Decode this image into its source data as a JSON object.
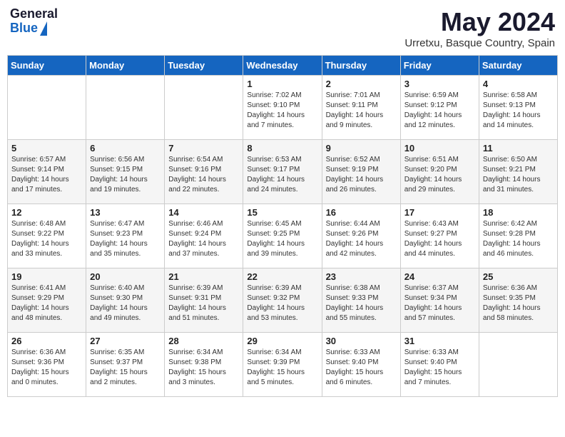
{
  "header": {
    "logo_general": "General",
    "logo_blue": "Blue",
    "month_year": "May 2024",
    "location": "Urretxu, Basque Country, Spain"
  },
  "weekdays": [
    "Sunday",
    "Monday",
    "Tuesday",
    "Wednesday",
    "Thursday",
    "Friday",
    "Saturday"
  ],
  "weeks": [
    [
      {
        "day": "",
        "info": ""
      },
      {
        "day": "",
        "info": ""
      },
      {
        "day": "",
        "info": ""
      },
      {
        "day": "1",
        "info": "Sunrise: 7:02 AM\nSunset: 9:10 PM\nDaylight: 14 hours\nand 7 minutes."
      },
      {
        "day": "2",
        "info": "Sunrise: 7:01 AM\nSunset: 9:11 PM\nDaylight: 14 hours\nand 9 minutes."
      },
      {
        "day": "3",
        "info": "Sunrise: 6:59 AM\nSunset: 9:12 PM\nDaylight: 14 hours\nand 12 minutes."
      },
      {
        "day": "4",
        "info": "Sunrise: 6:58 AM\nSunset: 9:13 PM\nDaylight: 14 hours\nand 14 minutes."
      }
    ],
    [
      {
        "day": "5",
        "info": "Sunrise: 6:57 AM\nSunset: 9:14 PM\nDaylight: 14 hours\nand 17 minutes."
      },
      {
        "day": "6",
        "info": "Sunrise: 6:56 AM\nSunset: 9:15 PM\nDaylight: 14 hours\nand 19 minutes."
      },
      {
        "day": "7",
        "info": "Sunrise: 6:54 AM\nSunset: 9:16 PM\nDaylight: 14 hours\nand 22 minutes."
      },
      {
        "day": "8",
        "info": "Sunrise: 6:53 AM\nSunset: 9:17 PM\nDaylight: 14 hours\nand 24 minutes."
      },
      {
        "day": "9",
        "info": "Sunrise: 6:52 AM\nSunset: 9:19 PM\nDaylight: 14 hours\nand 26 minutes."
      },
      {
        "day": "10",
        "info": "Sunrise: 6:51 AM\nSunset: 9:20 PM\nDaylight: 14 hours\nand 29 minutes."
      },
      {
        "day": "11",
        "info": "Sunrise: 6:50 AM\nSunset: 9:21 PM\nDaylight: 14 hours\nand 31 minutes."
      }
    ],
    [
      {
        "day": "12",
        "info": "Sunrise: 6:48 AM\nSunset: 9:22 PM\nDaylight: 14 hours\nand 33 minutes."
      },
      {
        "day": "13",
        "info": "Sunrise: 6:47 AM\nSunset: 9:23 PM\nDaylight: 14 hours\nand 35 minutes."
      },
      {
        "day": "14",
        "info": "Sunrise: 6:46 AM\nSunset: 9:24 PM\nDaylight: 14 hours\nand 37 minutes."
      },
      {
        "day": "15",
        "info": "Sunrise: 6:45 AM\nSunset: 9:25 PM\nDaylight: 14 hours\nand 39 minutes."
      },
      {
        "day": "16",
        "info": "Sunrise: 6:44 AM\nSunset: 9:26 PM\nDaylight: 14 hours\nand 42 minutes."
      },
      {
        "day": "17",
        "info": "Sunrise: 6:43 AM\nSunset: 9:27 PM\nDaylight: 14 hours\nand 44 minutes."
      },
      {
        "day": "18",
        "info": "Sunrise: 6:42 AM\nSunset: 9:28 PM\nDaylight: 14 hours\nand 46 minutes."
      }
    ],
    [
      {
        "day": "19",
        "info": "Sunrise: 6:41 AM\nSunset: 9:29 PM\nDaylight: 14 hours\nand 48 minutes."
      },
      {
        "day": "20",
        "info": "Sunrise: 6:40 AM\nSunset: 9:30 PM\nDaylight: 14 hours\nand 49 minutes."
      },
      {
        "day": "21",
        "info": "Sunrise: 6:39 AM\nSunset: 9:31 PM\nDaylight: 14 hours\nand 51 minutes."
      },
      {
        "day": "22",
        "info": "Sunrise: 6:39 AM\nSunset: 9:32 PM\nDaylight: 14 hours\nand 53 minutes."
      },
      {
        "day": "23",
        "info": "Sunrise: 6:38 AM\nSunset: 9:33 PM\nDaylight: 14 hours\nand 55 minutes."
      },
      {
        "day": "24",
        "info": "Sunrise: 6:37 AM\nSunset: 9:34 PM\nDaylight: 14 hours\nand 57 minutes."
      },
      {
        "day": "25",
        "info": "Sunrise: 6:36 AM\nSunset: 9:35 PM\nDaylight: 14 hours\nand 58 minutes."
      }
    ],
    [
      {
        "day": "26",
        "info": "Sunrise: 6:36 AM\nSunset: 9:36 PM\nDaylight: 15 hours\nand 0 minutes."
      },
      {
        "day": "27",
        "info": "Sunrise: 6:35 AM\nSunset: 9:37 PM\nDaylight: 15 hours\nand 2 minutes."
      },
      {
        "day": "28",
        "info": "Sunrise: 6:34 AM\nSunset: 9:38 PM\nDaylight: 15 hours\nand 3 minutes."
      },
      {
        "day": "29",
        "info": "Sunrise: 6:34 AM\nSunset: 9:39 PM\nDaylight: 15 hours\nand 5 minutes."
      },
      {
        "day": "30",
        "info": "Sunrise: 6:33 AM\nSunset: 9:40 PM\nDaylight: 15 hours\nand 6 minutes."
      },
      {
        "day": "31",
        "info": "Sunrise: 6:33 AM\nSunset: 9:40 PM\nDaylight: 15 hours\nand 7 minutes."
      },
      {
        "day": "",
        "info": ""
      }
    ]
  ]
}
